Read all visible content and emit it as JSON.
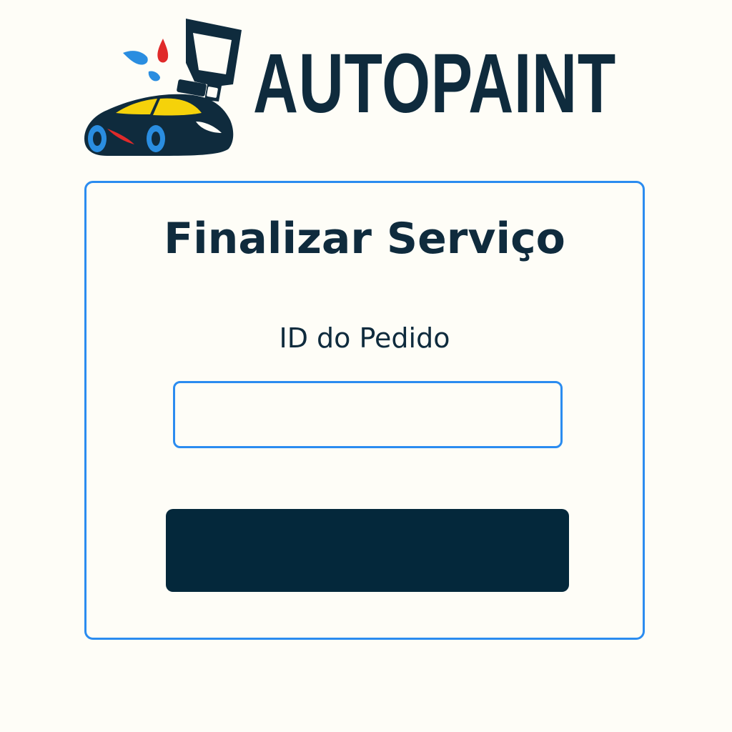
{
  "brand": {
    "name": "AUTOPAINT",
    "logo_icon": "car-paint-sprayer-icon"
  },
  "form": {
    "title": "Finalizar Serviço",
    "order_id_label": "ID do Pedido",
    "order_id_value": "",
    "order_id_placeholder": "",
    "submit_label": ""
  },
  "colors": {
    "background": "#fefdf7",
    "text_dark": "#0f2b3d",
    "accent_blue": "#2b8cf0",
    "button_dark": "#04283b",
    "logo_yellow": "#f5d20a",
    "logo_red": "#e02a2a",
    "logo_blue": "#2a8de0"
  }
}
